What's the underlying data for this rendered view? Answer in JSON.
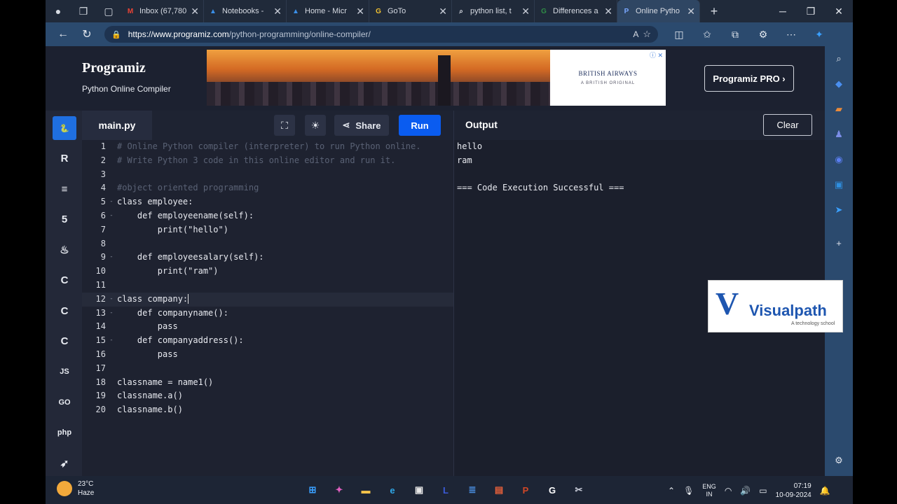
{
  "browser": {
    "tabs": [
      {
        "label": "Inbox (67,780",
        "icon": "gmail-icon",
        "color": "#ea4335",
        "glyph": "M",
        "active": false
      },
      {
        "label": "Notebooks -",
        "icon": "azure-icon",
        "color": "#3a8fe8",
        "glyph": "▲",
        "active": false
      },
      {
        "label": "Home - Micr",
        "icon": "azure-icon",
        "color": "#3a8fe8",
        "glyph": "▲",
        "active": false
      },
      {
        "label": "GoTo",
        "icon": "goto-icon",
        "color": "#f3c230",
        "glyph": "G",
        "active": false
      },
      {
        "label": "python list, t",
        "icon": "search-icon",
        "color": "#d7dbe3",
        "glyph": "⌕",
        "active": false
      },
      {
        "label": "Differences a",
        "icon": "gfg-icon",
        "color": "#2f8d46",
        "glyph": "G",
        "active": false
      },
      {
        "label": "Online Pytho",
        "icon": "programiz-icon",
        "color": "#7aa7ff",
        "glyph": "P",
        "active": true
      }
    ],
    "url_host": "https://www.programiz.com",
    "url_path": "/python-programming/online-compiler/",
    "read_aloud": "A"
  },
  "site": {
    "logo": "Programiz",
    "subtitle": "Python Online Compiler",
    "ad_brand": "BRITISH AIRWAYS",
    "ad_tag": "A BRITISH ORIGINAL",
    "pro_button": "Programiz PRO ›"
  },
  "sidebar": {
    "languages": [
      {
        "name": "python",
        "glyph": "🐍",
        "active": true
      },
      {
        "name": "r",
        "glyph": "R",
        "active": false
      },
      {
        "name": "sql",
        "glyph": "≡",
        "active": false
      },
      {
        "name": "html",
        "glyph": "5",
        "active": false
      },
      {
        "name": "java",
        "glyph": "♨",
        "active": false
      },
      {
        "name": "c",
        "glyph": "C",
        "active": false
      },
      {
        "name": "cpp",
        "glyph": "C",
        "active": false
      },
      {
        "name": "csharp",
        "glyph": "C",
        "active": false
      },
      {
        "name": "js",
        "glyph": "JS",
        "active": false
      },
      {
        "name": "go",
        "glyph": "GO",
        "active": false
      },
      {
        "name": "php",
        "glyph": "php",
        "active": false
      },
      {
        "name": "swift",
        "glyph": "➶",
        "active": false
      }
    ]
  },
  "editor": {
    "filename": "main.py",
    "share_label": "Share",
    "run_label": "Run",
    "lines": [
      {
        "n": "1",
        "fold": "",
        "text": "# Online Python compiler (interpreter) to run Python online.",
        "cls": "cmt"
      },
      {
        "n": "2",
        "fold": "",
        "text": "# Write Python 3 code in this online editor and run it.",
        "cls": "cmt"
      },
      {
        "n": "3",
        "fold": "",
        "text": "",
        "cls": ""
      },
      {
        "n": "4",
        "fold": "",
        "text": "#object oriented programming",
        "cls": "cmt"
      },
      {
        "n": "5",
        "fold": "-",
        "text": "class employee:",
        "cls": ""
      },
      {
        "n": "6",
        "fold": "-",
        "text": "    def employeename(self):",
        "cls": ""
      },
      {
        "n": "7",
        "fold": "",
        "text": "        print(\"hello\")",
        "cls": ""
      },
      {
        "n": "8",
        "fold": "",
        "text": "",
        "cls": ""
      },
      {
        "n": "9",
        "fold": "-",
        "text": "    def employeesalary(self):",
        "cls": ""
      },
      {
        "n": "10",
        "fold": "",
        "text": "        print(\"ram\")",
        "cls": ""
      },
      {
        "n": "11",
        "fold": "",
        "text": "",
        "cls": ""
      },
      {
        "n": "12",
        "fold": "-",
        "text": "class company:",
        "cls": "cur"
      },
      {
        "n": "13",
        "fold": "-",
        "text": "    def companyname():",
        "cls": ""
      },
      {
        "n": "14",
        "fold": "",
        "text": "        pass",
        "cls": ""
      },
      {
        "n": "15",
        "fold": "-",
        "text": "    def companyaddress():",
        "cls": ""
      },
      {
        "n": "16",
        "fold": "",
        "text": "        pass",
        "cls": ""
      },
      {
        "n": "17",
        "fold": "",
        "text": "",
        "cls": ""
      },
      {
        "n": "18",
        "fold": "",
        "text": "classname = name1()",
        "cls": ""
      },
      {
        "n": "19",
        "fold": "",
        "text": "classname.a()",
        "cls": ""
      },
      {
        "n": "20",
        "fold": "",
        "text": "classname.b()",
        "cls": ""
      }
    ]
  },
  "output": {
    "title": "Output",
    "clear_label": "Clear",
    "lines": [
      "hello",
      "ram",
      "",
      "=== Code Execution Successful ==="
    ]
  },
  "watermark": {
    "letter": "V",
    "name": "Visualpath",
    "tag": "A technology school"
  },
  "taskbar": {
    "temp": "23°C",
    "weather": "Haze",
    "lang1": "ENG",
    "lang2": "IN",
    "time": "07:19",
    "date": "10-09-2024",
    "apps": [
      {
        "name": "windows-start-icon",
        "glyph": "⊞",
        "color": "#3aa0ff"
      },
      {
        "name": "copilot-icon",
        "glyph": "✦",
        "color": "#e060c0"
      },
      {
        "name": "file-explorer-icon",
        "glyph": "▬",
        "color": "#f4c24a"
      },
      {
        "name": "edge-icon",
        "glyph": "e",
        "color": "#2fa8e8"
      },
      {
        "name": "store-icon",
        "glyph": "▣",
        "color": "#e8e8e8"
      },
      {
        "name": "l-app-icon",
        "glyph": "L",
        "color": "#3b5bd8"
      },
      {
        "name": "notes-app-icon",
        "glyph": "≣",
        "color": "#4a90e2"
      },
      {
        "name": "ilovepdf-icon",
        "glyph": "▤",
        "color": "#e8603a"
      },
      {
        "name": "powerpoint-icon",
        "glyph": "P",
        "color": "#d24726"
      },
      {
        "name": "chrome-g-icon",
        "glyph": "G",
        "color": "#ffffff"
      },
      {
        "name": "snipping-tool-icon",
        "glyph": "✂",
        "color": "#c8ccd8"
      }
    ]
  }
}
